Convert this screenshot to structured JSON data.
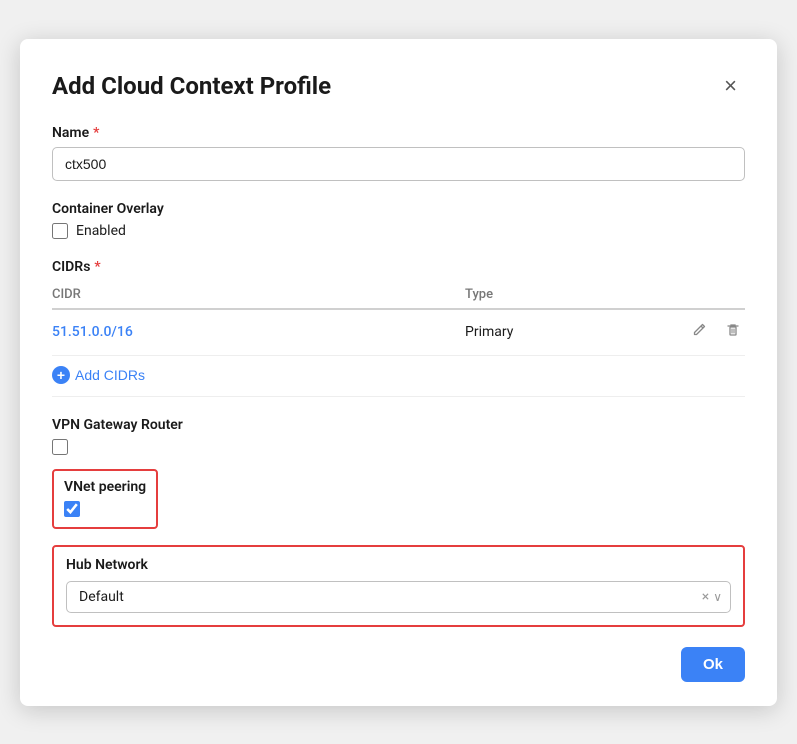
{
  "modal": {
    "title": "Add Cloud Context Profile",
    "close_label": "×"
  },
  "name_field": {
    "label": "Name",
    "required": true,
    "value": "ctx500",
    "placeholder": ""
  },
  "container_overlay": {
    "label": "Container Overlay",
    "checkbox_label": "Enabled",
    "checked": false
  },
  "cidrs": {
    "label": "CIDRs",
    "required": true,
    "col_cidr": "CIDR",
    "col_type": "Type",
    "rows": [
      {
        "cidr": "51.51.0.0/16",
        "type": "Primary"
      }
    ],
    "add_label": "Add CIDRs"
  },
  "vpn_gateway_router": {
    "label": "VPN Gateway Router",
    "checked": false
  },
  "vnet_peering": {
    "label": "VNet peering",
    "checked": true
  },
  "hub_network": {
    "label": "Hub Network",
    "value": "Default",
    "clear_icon": "×",
    "arrow_icon": "∨"
  },
  "footer": {
    "ok_label": "Ok"
  }
}
